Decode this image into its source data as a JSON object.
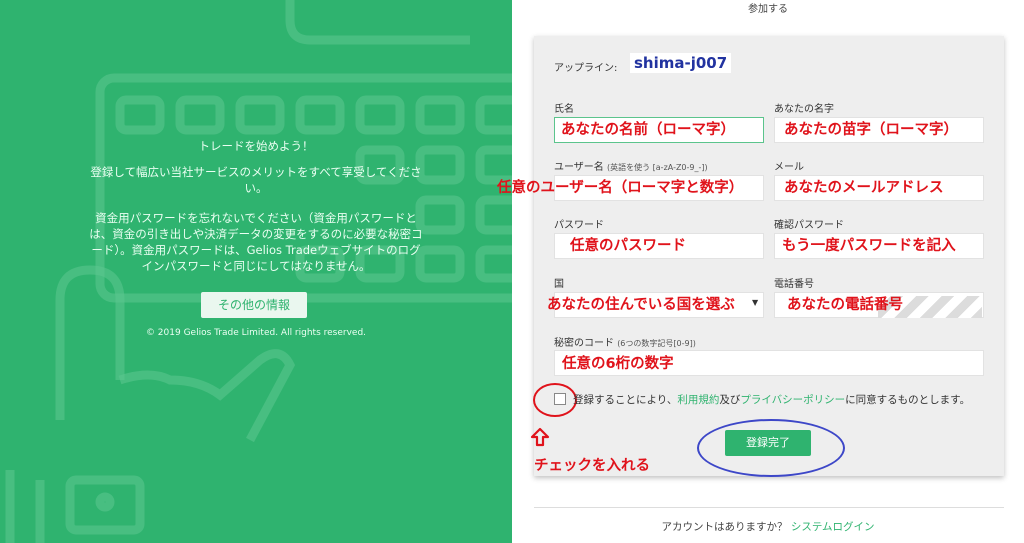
{
  "left": {
    "heading": "トレードを始めよう！",
    "intro_line1": "登録して幅広い当社サービスのメリットをすべて享受してくださ",
    "intro_line2": "い。",
    "warn_line1": "資金用パスワードを忘れないでください（資金用パスワードと",
    "warn_line2": "は、資金の引き出しや決済データの変更をするのに必要な秘密コ",
    "warn_line3": "ード）。資金用パスワードは、Gelios Tradeウェブサイトのログ",
    "warn_line4": "インパスワードと同じにしてはなりません。",
    "info_button": "その他の情報",
    "copyright": "© 2019 Gelios Trade Limited. All rights reserved."
  },
  "page_title": "参加する",
  "form": {
    "upline_label": "アップライン:",
    "upline_value": "shima-j007",
    "first_name_label": "氏名",
    "last_name_label": "あなたの名字",
    "username_label": "ユーザー名",
    "username_hint": "(英語を使う [a-zA-Z0-9_-])",
    "email_label": "メール",
    "password_label": "パスワード",
    "confirm_password_label": "確認パスワード",
    "country_label": "国",
    "phone_label": "電話番号",
    "secret_label": "秘密のコード",
    "secret_hint": "(6つの数字記号[0-9])",
    "agree_prefix": "登録することにより、",
    "terms_link": "利用規約",
    "agree_and": "及び",
    "privacy_link": "プライバシーポリシー",
    "agree_suffix": "に同意するものとします。",
    "submit_label": "登録完了"
  },
  "annotations": {
    "first_name": "あなたの名前（ローマ字）",
    "last_name": "あなたの苗字（ローマ字）",
    "username": "任意のユーザー名（ローマ字と数字）",
    "email": "あなたのメールアドレス",
    "password": "任意のパスワード",
    "confirm_password": "もう一度パスワードを記入",
    "country": "あなたの住んでいる国を選ぶ",
    "phone": "あなたの電話番号",
    "secret": "任意の6桁の数字",
    "check": "チェックを入れる"
  },
  "footer": {
    "question": "アカウントはありますか？",
    "login_link": "システムログイン"
  },
  "colors": {
    "brand_green": "#2fb36f",
    "annotation_red": "#e0131b",
    "annotation_blue": "#3d47c8"
  }
}
